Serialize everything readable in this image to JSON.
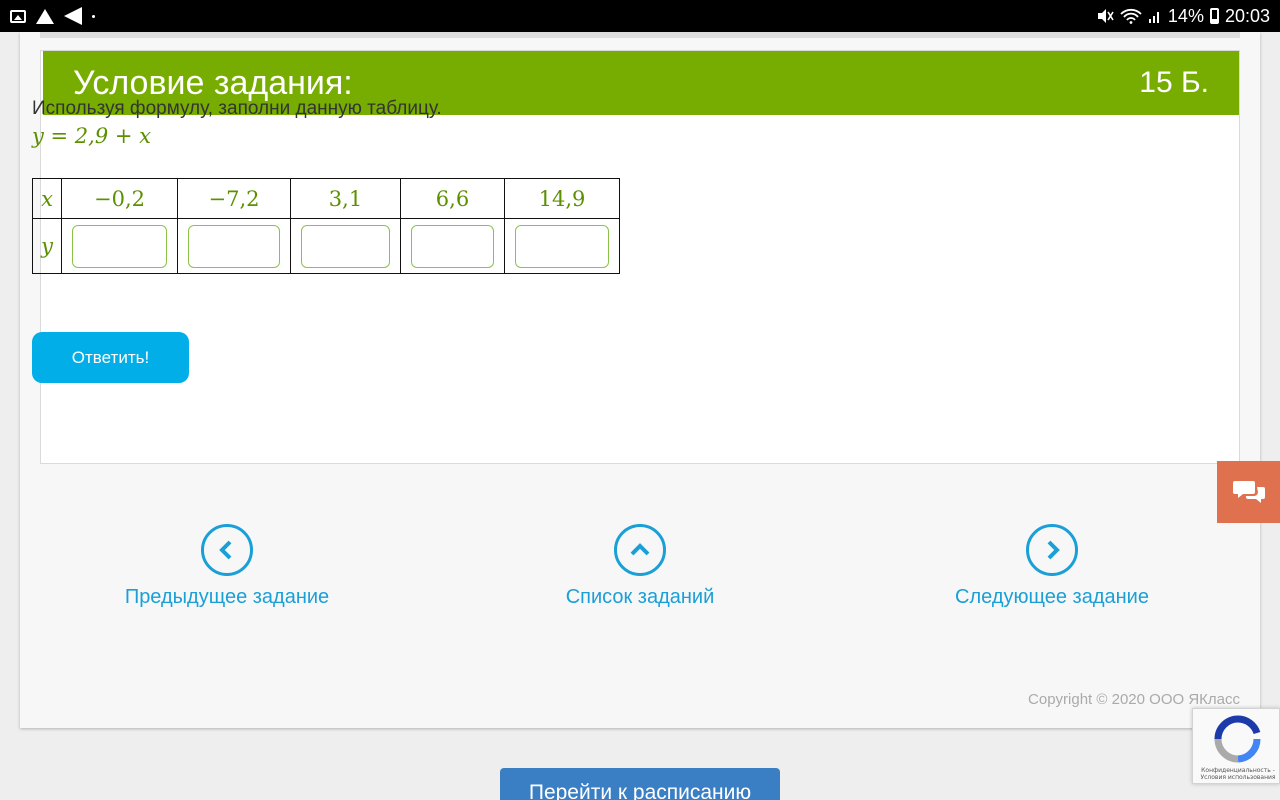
{
  "status_bar": {
    "battery": "14%",
    "time": "20:03"
  },
  "task": {
    "header_title": "Условие задания:",
    "points": "15 Б.",
    "instruction": "Используя формулу, заполни данную таблицу.",
    "formula": "y = 2,9 + x",
    "table": {
      "x_label": "x",
      "y_label": "y",
      "x_values": [
        "−0,2",
        "−7,2",
        "3,1",
        "6,6",
        "14,9"
      ],
      "y_values": [
        "",
        "",
        "",
        "",
        ""
      ]
    },
    "answer_button": "Ответить!"
  },
  "navigation": {
    "prev_label": "Предыдущее задание",
    "list_label": "Список заданий",
    "next_label": "Следующее задание"
  },
  "footer": {
    "copyright": "Copyright © 2020 ООО ЯКласс"
  },
  "recaptcha": {
    "text": "Конфиденциальность - Условия использования"
  },
  "schedule_button": "Перейти к расписанию",
  "colors": {
    "header_green": "#77ad00",
    "math_green": "#5c9000",
    "button_blue": "#01aee8",
    "nav_blue": "#1a9fd6",
    "chat_orange": "#e0714f"
  }
}
